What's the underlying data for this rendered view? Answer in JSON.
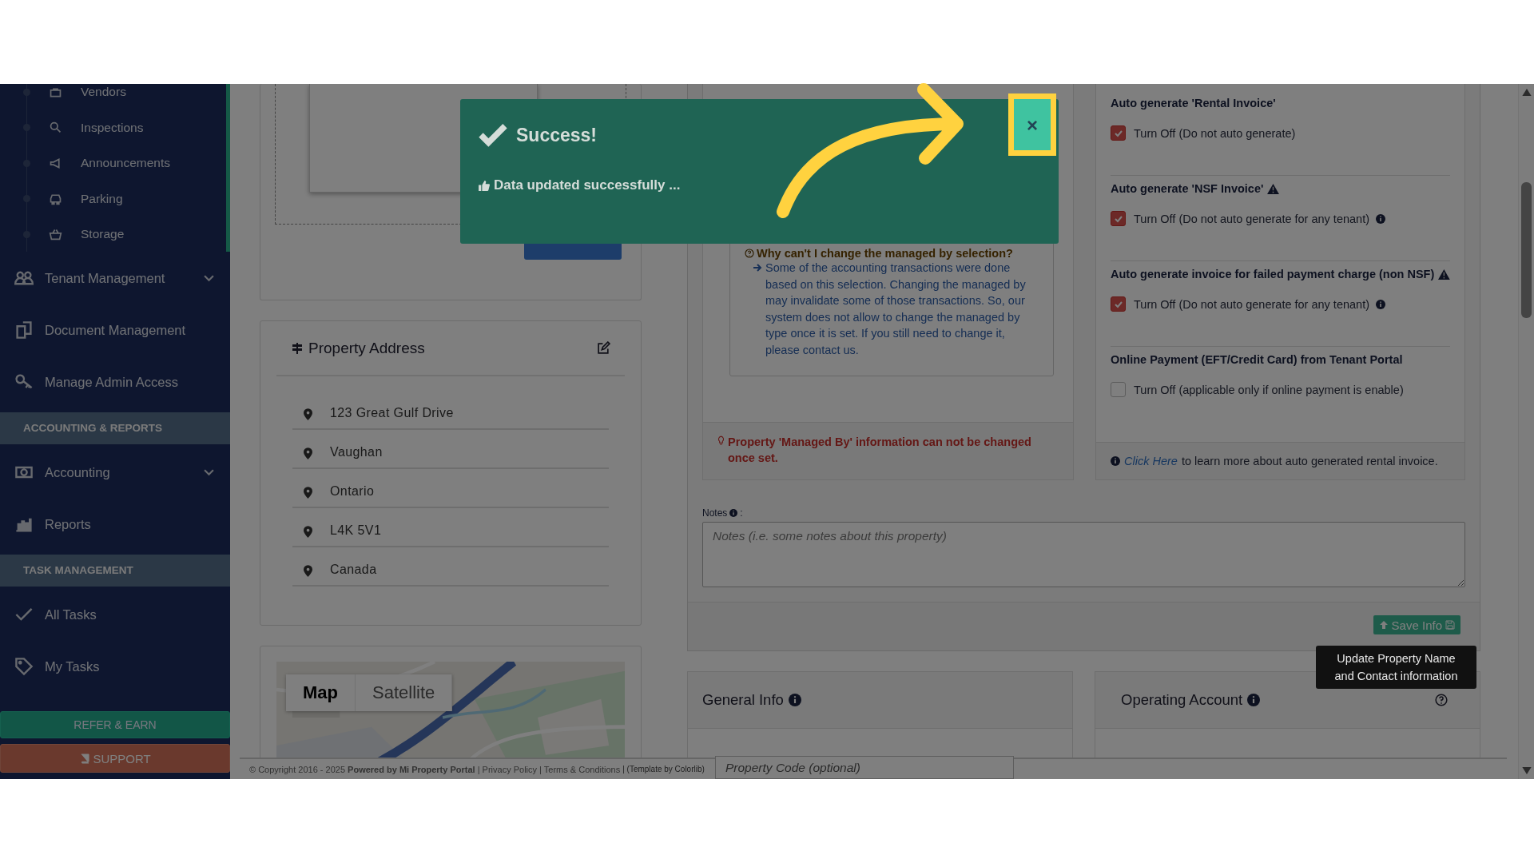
{
  "sidebar": {
    "items": [
      {
        "kind": "sub",
        "label": "Vendors"
      },
      {
        "kind": "sub",
        "label": "Inspections"
      },
      {
        "kind": "sub",
        "label": "Announcements"
      },
      {
        "kind": "sub",
        "label": "Parking"
      },
      {
        "kind": "sub",
        "label": "Storage"
      },
      {
        "kind": "nav",
        "label": "Tenant Management",
        "expandable": true
      },
      {
        "kind": "nav",
        "label": "Document Management",
        "expandable": false
      },
      {
        "kind": "nav",
        "label": "Manage Admin Access",
        "expandable": false
      },
      {
        "kind": "section",
        "label": "ACCOUNTING & REPORTS"
      },
      {
        "kind": "nav",
        "label": "Accounting",
        "expandable": true
      },
      {
        "kind": "nav",
        "label": "Reports",
        "expandable": false
      },
      {
        "kind": "section",
        "label": "TASK MANAGEMENT"
      },
      {
        "kind": "nav",
        "label": "All Tasks",
        "expandable": false
      },
      {
        "kind": "nav",
        "label": "My Tasks",
        "expandable": false
      }
    ],
    "refer_button": "REFER & EARN",
    "support_button": "SUPPORT"
  },
  "address": {
    "title": "Property Address",
    "lines": [
      "123 Great Gulf Drive",
      "Vaughan",
      "Ontario",
      "L4K 5V1",
      "Canada"
    ]
  },
  "map": {
    "tabs": [
      {
        "label": "Map",
        "selected": true
      },
      {
        "label": "Satellite",
        "selected": false
      }
    ]
  },
  "managed_by": {
    "help_title": "Why can't I change the managed by selection?",
    "help_text": "Some of the accounting transactions were done based on this selection. Changing the managed by may invalidate some of those transactions. So, our system does not allow to change the managed by type once it is set. If you still need to change it, please contact us.",
    "warning": "Property 'Managed By' information can not be changed once set."
  },
  "auto_settings": {
    "groups": [
      {
        "title": "Auto generate 'Rental Invoice'",
        "warning": false,
        "option": "Turn Off (Do not auto generate)",
        "info": false,
        "checked": true
      },
      {
        "title": "Auto generate 'NSF Invoice'",
        "warning": true,
        "option": "Turn Off (Do not auto generate for any tenant)",
        "info": true,
        "checked": true
      },
      {
        "title": "Auto generate invoice for failed payment charge (non NSF)",
        "warning": true,
        "option": "Turn Off (Do not auto generate for any tenant)",
        "info": true,
        "checked": true
      },
      {
        "title": "Online Payment (EFT/Credit Card) from Tenant Portal",
        "warning": false,
        "option": "Turn Off (applicable only if online payment is enable)",
        "info": false,
        "checked": false
      }
    ],
    "learn_link": "Click Here",
    "learn_text": "to learn more about auto generated rental invoice."
  },
  "notes": {
    "label": "Notes",
    "suffix": ":",
    "placeholder": "Notes (i.e. some notes about this property)"
  },
  "save_button": "Save Info",
  "tooltip": "Update Property Name and Contact information",
  "cards": [
    {
      "title": "General Info",
      "help": false
    },
    {
      "title": "Operating Account",
      "help": true
    }
  ],
  "footer": {
    "copyright": "© Copyright 2016 - 2025 **Powered by Mi Property Portal** | Privacy Policy | Terms & Conditions",
    "template": "| (Template by Colorlib)"
  },
  "property_code": {
    "placeholder": "Property Code (optional)"
  },
  "toast": {
    "title": "Success!",
    "message": "Data updated successfully ...",
    "close": "×"
  }
}
